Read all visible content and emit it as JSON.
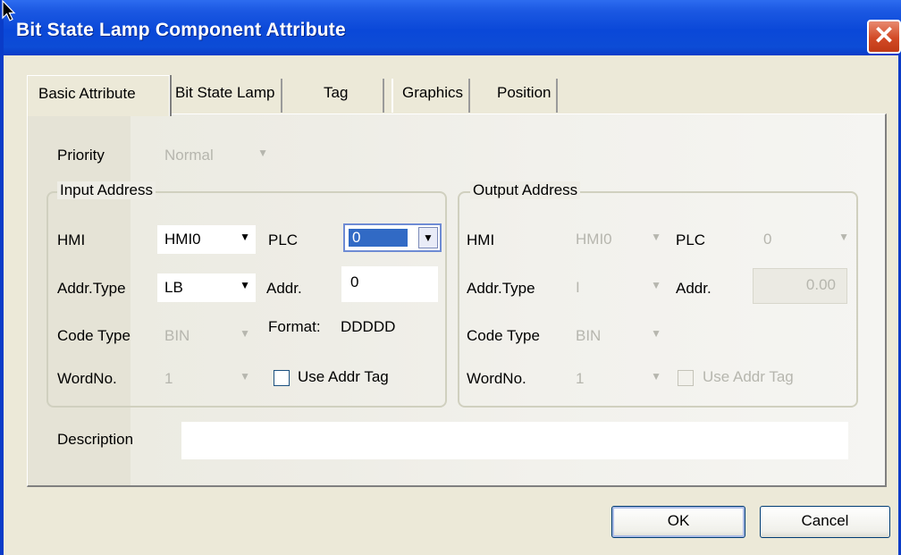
{
  "window": {
    "title": "Bit State Lamp Component Attribute"
  },
  "tabs": [
    {
      "label": "Basic Attribute",
      "active": true
    },
    {
      "label": "Bit State Lamp",
      "active": false
    },
    {
      "label": "Tag",
      "active": false
    },
    {
      "label": "Graphics",
      "active": false
    },
    {
      "label": "Position",
      "active": false
    }
  ],
  "priority": {
    "label": "Priority",
    "value": "Normal"
  },
  "input_address": {
    "title": "Input Address",
    "hmi_label": "HMI",
    "hmi_value": "HMI0",
    "plc_label": "PLC",
    "plc_value": "0",
    "addr_type_label": "Addr.Type",
    "addr_type_value": "LB",
    "addr_label": "Addr.",
    "addr_value": "0",
    "code_type_label": "Code Type",
    "code_type_value": "BIN",
    "format_label": "Format:",
    "format_value": "DDDDD",
    "wordno_label": "WordNo.",
    "wordno_value": "1",
    "use_addr_tag_label": "Use Addr Tag"
  },
  "output_address": {
    "title": "Output Address",
    "hmi_label": "HMI",
    "hmi_value": "HMI0",
    "plc_label": "PLC",
    "plc_value": "0",
    "addr_type_label": "Addr.Type",
    "addr_type_value": "I",
    "addr_label": "Addr.",
    "addr_value": "0.00",
    "code_type_label": "Code Type",
    "code_type_value": "BIN",
    "wordno_label": "WordNo.",
    "wordno_value": "1",
    "use_addr_tag_label": "Use Addr Tag"
  },
  "description": {
    "label": "Description",
    "value": ""
  },
  "buttons": {
    "ok": "OK",
    "cancel": "Cancel"
  },
  "icons": {
    "close": "close-icon",
    "dropdown": "chevron-down-icon",
    "cursor": "mouse-pointer-icon"
  },
  "colors": {
    "titlebar": "#0a48d8",
    "close": "#d24a26",
    "selection": "#316ac5",
    "dialog": "#ece9d8"
  }
}
